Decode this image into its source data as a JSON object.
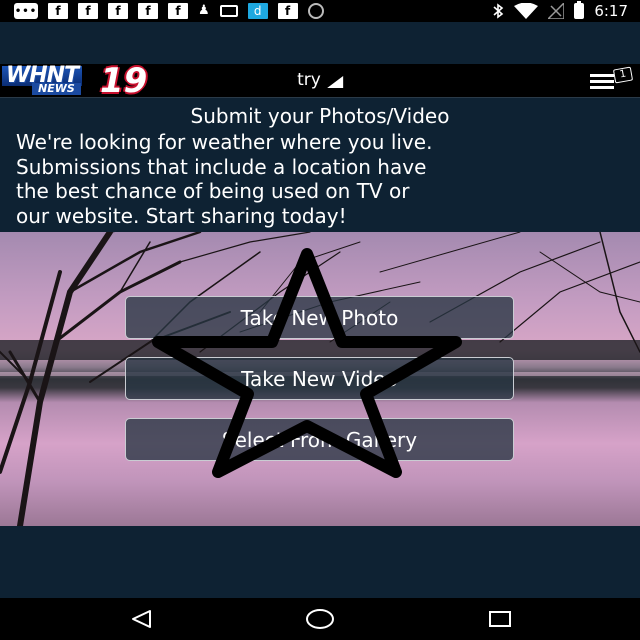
{
  "status_bar": {
    "icons_left": [
      "message-icon",
      "facebook-icon",
      "facebook-icon",
      "facebook-icon",
      "facebook-icon",
      "facebook-icon",
      "chess-pawn-icon",
      "sim-card-icon",
      "dictionary-icon",
      "facebook-icon",
      "settings-circle-icon"
    ],
    "chat_label": "•••",
    "fb_label": "f",
    "d_label": "d",
    "icons_right": [
      "bluetooth-icon",
      "wifi-icon",
      "no-signal-icon",
      "battery-charging-icon"
    ],
    "time": "6:17"
  },
  "app_bar": {
    "logo_text": "WHNT",
    "logo_sub": "NEWS",
    "logo_number": "19",
    "title": "try",
    "menu_badge": "1"
  },
  "intro": {
    "title": "Submit your Photos/Video",
    "body_lines": [
      "We're looking for weather where you live.",
      "Submissions that include a location have",
      "the best chance of being used on TV or",
      "our website. Start sharing today!"
    ]
  },
  "actions": {
    "take_photo": "Take New Photo",
    "take_video": "Take New Video",
    "select_gallery": "Select From Gallery"
  },
  "overlay": {
    "star_icon": "star-outline-icon"
  },
  "nav_bar": {
    "back": "back-icon",
    "home": "home-icon",
    "recents": "recents-icon"
  },
  "colors": {
    "page_bg": "#0e2233",
    "bar_bg": "#000000",
    "button_border": "#c9ccd2"
  }
}
